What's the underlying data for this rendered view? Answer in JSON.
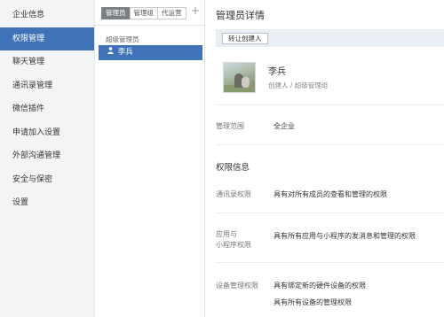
{
  "nav": {
    "items": [
      {
        "label": "企业信息"
      },
      {
        "label": "权限管理",
        "active": true
      },
      {
        "label": "聊天管理"
      },
      {
        "label": "通讯录管理"
      },
      {
        "label": "微信插件"
      },
      {
        "label": "申请加入设置"
      },
      {
        "label": "外部沟通管理"
      },
      {
        "label": "安全与保密"
      },
      {
        "label": "设置"
      }
    ]
  },
  "middle": {
    "tabs": [
      {
        "label": "管理员",
        "active": true
      },
      {
        "label": "管理组"
      },
      {
        "label": "代运营"
      }
    ],
    "add_symbol": "+",
    "group_label": "超级管理员",
    "member": {
      "name": "李兵",
      "icon": "person-icon"
    }
  },
  "detail": {
    "title": "管理员详情",
    "transfer_button": "转让创建人",
    "user": {
      "name": "李兵",
      "role": "创建人 / 超级管理组"
    },
    "scope": {
      "label": "管理范围",
      "value": "全企业"
    },
    "permissions_title": "权限信息",
    "permissions": [
      {
        "label_lines": [
          "通讯录权限"
        ],
        "values": [
          "具有对所有成员的查看和管理的权限"
        ]
      },
      {
        "label_lines": [
          "应用与",
          "小程序权限"
        ],
        "values": [
          "具有所有应用与小程序的发消息和管理的权限"
        ]
      },
      {
        "label_lines": [
          "设备管理权限"
        ],
        "values": [
          "具有绑定新的硬件设备的权限",
          "具有所有设备的管理权限"
        ]
      }
    ]
  },
  "colors": {
    "accent": "#3f72b6",
    "nav_bg": "#f3f4f6",
    "toolbar_bg": "#e9eef5"
  }
}
